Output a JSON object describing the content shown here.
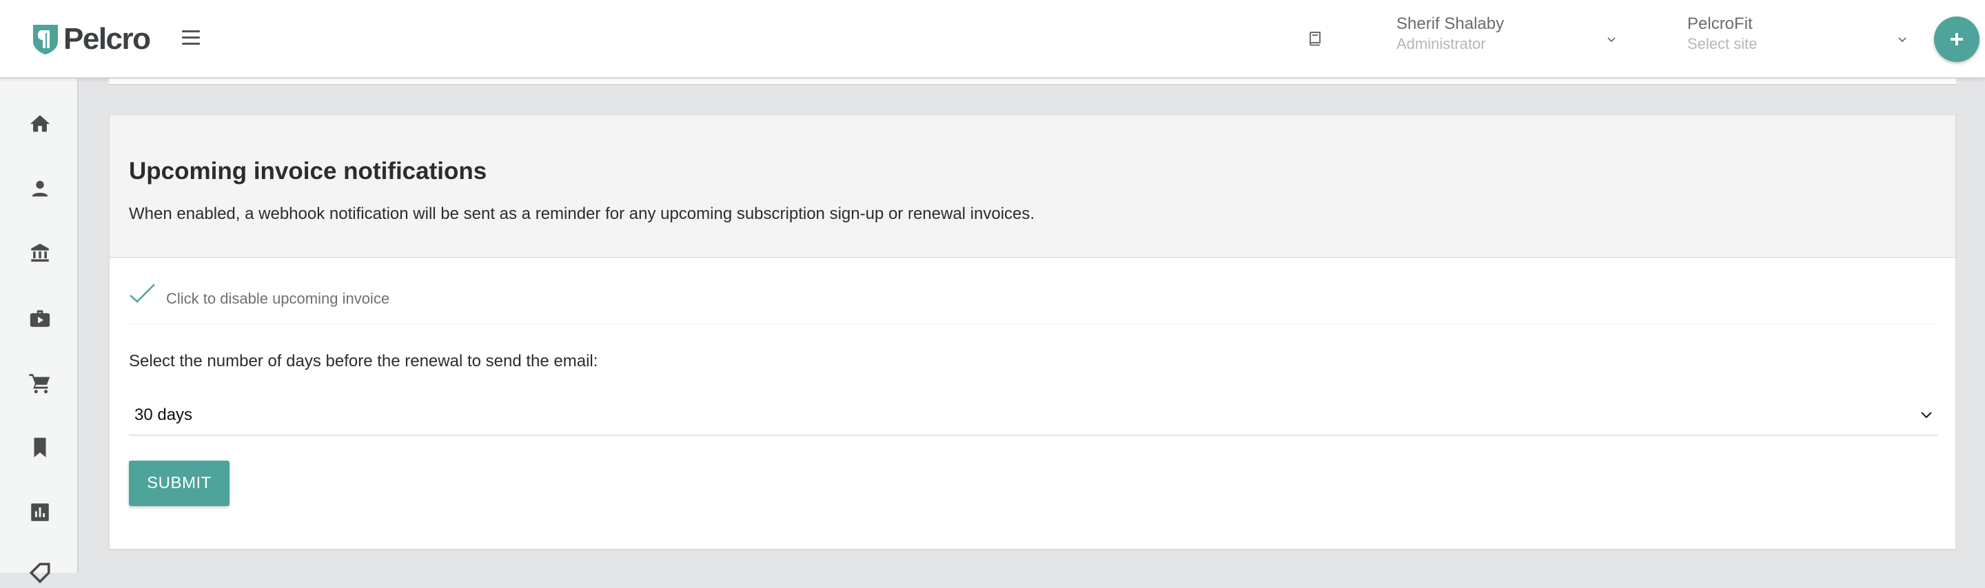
{
  "brand": {
    "name": "Pelcro",
    "accent": "#4ea39a"
  },
  "header": {
    "user_name": "Sherif Shalaby",
    "user_role": "Administrator",
    "site_name": "PelcroFit",
    "site_placeholder": "Select site",
    "icons": [
      "menu-icon",
      "book-icon",
      "chevron-down-icon",
      "plus-icon"
    ]
  },
  "sidebar": {
    "items": [
      {
        "icon": "home-icon"
      },
      {
        "icon": "person-icon"
      },
      {
        "icon": "bank-icon"
      },
      {
        "icon": "briefcase-play-icon"
      },
      {
        "icon": "cart-icon"
      },
      {
        "icon": "bookmark-icon"
      },
      {
        "icon": "chart-icon"
      },
      {
        "icon": "tag-icon"
      }
    ]
  },
  "main": {
    "title": "Upcoming invoice notifications",
    "description": "When enabled, a webhook notification will be sent as a reminder for any upcoming subscription sign-up or renewal invoices.",
    "toggle_label": "Click to disable upcoming invoice",
    "toggle_checked": true,
    "days_label": "Select the number of days before the renewal to send the email:",
    "days_value": "30 days",
    "submit_label": "SUBMIT"
  }
}
